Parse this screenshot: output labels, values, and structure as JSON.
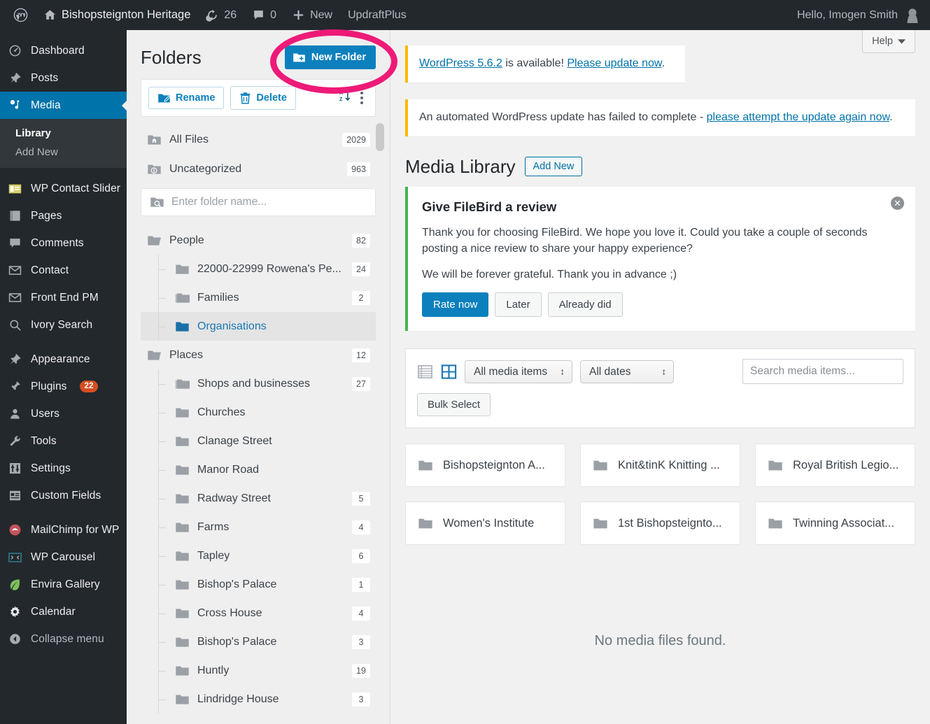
{
  "adminbar": {
    "site_name": "Bishopsteignton Heritage",
    "updates_count": "26",
    "comments_count": "0",
    "new_label": "New",
    "updraftplus_label": "UpdraftPlus",
    "howdy": "Hello, Imogen Smith",
    "wp_logo_icon": "wordpress-logo-icon",
    "home_icon": "home-icon",
    "updates_icon": "updates-refresh-icon",
    "comments_icon": "comment-bubble-icon",
    "new_icon": "plus-icon",
    "avatar_icon": "user-avatar-icon"
  },
  "sidebar": {
    "items": [
      {
        "label": "Dashboard",
        "icon": "dashboard-icon",
        "current": false
      },
      {
        "label": "Posts",
        "icon": "pin-icon",
        "current": false
      },
      {
        "label": "Media",
        "icon": "media-icon",
        "current": true
      },
      {
        "label": "WP Contact Slider",
        "icon": "contact-slider-icon",
        "current": false
      },
      {
        "label": "Pages",
        "icon": "pages-icon",
        "current": false
      },
      {
        "label": "Comments",
        "icon": "comments-icon",
        "current": false
      },
      {
        "label": "Contact",
        "icon": "envelope-icon",
        "current": false
      },
      {
        "label": "Front End PM",
        "icon": "envelope-icon",
        "current": false
      },
      {
        "label": "Ivory Search",
        "icon": "search-icon",
        "current": false
      },
      {
        "label": "Appearance",
        "icon": "paintbrush-icon",
        "current": false
      },
      {
        "label": "Plugins",
        "icon": "plug-icon",
        "badge": "22",
        "current": false
      },
      {
        "label": "Users",
        "icon": "user-icon",
        "current": false
      },
      {
        "label": "Tools",
        "icon": "wrench-icon",
        "current": false
      },
      {
        "label": "Settings",
        "icon": "sliders-icon",
        "current": false
      },
      {
        "label": "Custom Fields",
        "icon": "custom-fields-icon",
        "current": false
      },
      {
        "label": "MailChimp for WP",
        "icon": "mailchimp-icon",
        "current": false
      },
      {
        "label": "WP Carousel",
        "icon": "carousel-icon",
        "current": false
      },
      {
        "label": "Envira Gallery",
        "icon": "leaf-icon",
        "current": false
      },
      {
        "label": "Calendar",
        "icon": "gear-icon",
        "current": false
      }
    ],
    "submenu": [
      {
        "label": "Library",
        "active": true
      },
      {
        "label": "Add New",
        "active": false
      }
    ],
    "collapse_label": "Collapse menu",
    "collapse_icon": "collapse-arrow-icon"
  },
  "folders_panel": {
    "title": "Folders",
    "new_folder_label": "New Folder",
    "new_folder_icon": "folder-plus-icon",
    "rename_label": "Rename",
    "rename_icon": "folder-pencil-icon",
    "delete_label": "Delete",
    "delete_icon": "trash-icon",
    "sort_icon": "sort-az-icon",
    "more_icon": "kebab-menu-icon",
    "search_placeholder": "Enter folder name...",
    "search_icon": "folder-search-icon",
    "quick_rows": [
      {
        "label": "All Files",
        "count": "2029",
        "icon": "folder-home-icon"
      },
      {
        "label": "Uncategorized",
        "count": "963",
        "icon": "folder-info-icon"
      }
    ],
    "tree": [
      {
        "label": "People",
        "count": "82",
        "level": 0,
        "selected": false,
        "icon": "folder-open-icon"
      },
      {
        "label": "22000-22999 Rowena's Pe...",
        "count": "24",
        "level": 1,
        "selected": false,
        "icon": "folder-icon"
      },
      {
        "label": "Families",
        "count": "2",
        "level": 1,
        "selected": false,
        "icon": "folder-stack-icon"
      },
      {
        "label": "Organisations",
        "count": "",
        "level": 1,
        "selected": true,
        "icon": "folder-icon"
      },
      {
        "label": "Places",
        "count": "12",
        "level": 0,
        "selected": false,
        "icon": "folder-open-icon"
      },
      {
        "label": "Shops and businesses",
        "count": "27",
        "level": 1,
        "selected": false,
        "icon": "folder-stack-icon"
      },
      {
        "label": "Churches",
        "count": "",
        "level": 1,
        "selected": false,
        "icon": "folder-icon"
      },
      {
        "label": "Clanage Street",
        "count": "",
        "level": 1,
        "selected": false,
        "icon": "folder-icon"
      },
      {
        "label": "Manor Road",
        "count": "",
        "level": 1,
        "selected": false,
        "icon": "folder-icon"
      },
      {
        "label": "Radway Street",
        "count": "5",
        "level": 1,
        "selected": false,
        "icon": "folder-icon"
      },
      {
        "label": "Farms",
        "count": "4",
        "level": 1,
        "selected": false,
        "icon": "folder-icon"
      },
      {
        "label": "Tapley",
        "count": "6",
        "level": 1,
        "selected": false,
        "icon": "folder-icon"
      },
      {
        "label": "Bishop's Palace",
        "count": "1",
        "level": 1,
        "selected": false,
        "icon": "folder-icon"
      },
      {
        "label": "Cross House",
        "count": "4",
        "level": 1,
        "selected": false,
        "icon": "folder-icon"
      },
      {
        "label": "Bishop's Palace",
        "count": "3",
        "level": 1,
        "selected": false,
        "icon": "folder-icon"
      },
      {
        "label": "Huntly",
        "count": "19",
        "level": 1,
        "selected": false,
        "icon": "folder-icon"
      },
      {
        "label": "Lindridge House",
        "count": "3",
        "level": 1,
        "selected": false,
        "icon": "folder-icon"
      }
    ]
  },
  "content": {
    "help_label": "Help",
    "help_icon": "chevron-down-icon",
    "notice_update": {
      "link_version": "WordPress 5.6.2",
      "mid_text": " is available! ",
      "link_action": "Please update now",
      "tail": "."
    },
    "notice_failed": {
      "text": "An automated WordPress update has failed to complete - ",
      "link": "please attempt the update again now",
      "tail": "."
    },
    "page_title": "Media Library",
    "add_new_label": "Add New",
    "review": {
      "heading": "Give FileBird a review",
      "para1": "Thank you for choosing FileBird. We hope you love it. Could you take a couple of seconds posting a nice review to share your happy experience?",
      "para2": "We will be forever grateful. Thank you in advance ;)",
      "rate_now_label": "Rate now",
      "later_label": "Later",
      "already_did_label": "Already did",
      "dismiss_icon": "close-icon",
      "accent_color": "#46b450"
    },
    "toolbar": {
      "list_view_icon": "list-view-icon",
      "grid_view_icon": "grid-view-icon",
      "media_type_value": "All media items",
      "dates_value": "All dates",
      "search_placeholder": "Search media items...",
      "bulk_select_label": "Bulk Select"
    },
    "folder_cards": [
      {
        "label": "Bishopsteignton A...",
        "icon": "folder-icon"
      },
      {
        "label": "Knit&tinK Knitting ...",
        "icon": "folder-icon"
      },
      {
        "label": "Royal British Legio...",
        "icon": "folder-icon"
      },
      {
        "label": "Women's Institute",
        "icon": "folder-icon"
      },
      {
        "label": "1st Bishopsteignto...",
        "icon": "folder-icon"
      },
      {
        "label": "Twinning Associat...",
        "icon": "folder-icon"
      }
    ],
    "empty_message": "No media files found."
  },
  "annotation": {
    "shape": "ellipse-highlight",
    "color": "#ee1a78"
  },
  "colors": {
    "wp_blue": "#0073aa",
    "button_blue": "#0c80bd",
    "admin_dark": "#23282d",
    "submenu_dark": "#32373c",
    "notice_yellow": "#ffb900",
    "badge_orange": "#d54e21",
    "annotation_pink": "#ee1a78"
  }
}
